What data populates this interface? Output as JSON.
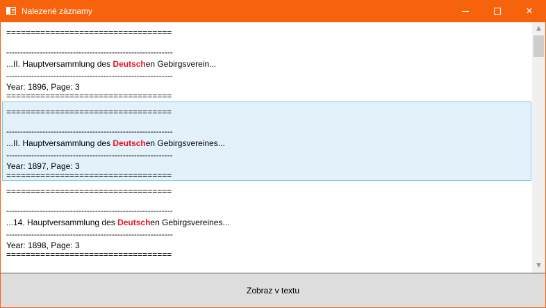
{
  "window": {
    "title": "Nalezené záznamy",
    "controls": {
      "minimize": "minimize",
      "maximize": "maximize",
      "close": "✕"
    }
  },
  "records": [
    {
      "sep_top": "==================================",
      "dash_a": "------------------------------------------------------------",
      "prefix": "...II. Hauptversammlung des ",
      "highlight": "Deutsch",
      "suffix": "en Gebirgsverein...",
      "dash_b": "------------------------------------------------------------",
      "meta": "Year: 1896, Page: 3",
      "sep_bottom": "==================================",
      "selected": false
    },
    {
      "sep_top": "==================================",
      "dash_a": "------------------------------------------------------------",
      "prefix": "...II. Hauptversammlung des ",
      "highlight": "Deutsch",
      "suffix": "en Gebirgsvereines...",
      "dash_b": "------------------------------------------------------------",
      "meta": "Year: 1897, Page: 3",
      "sep_bottom": "==================================",
      "selected": true
    },
    {
      "sep_top": "==================================",
      "dash_a": "------------------------------------------------------------",
      "prefix": "...14. Hauptversammlung des ",
      "highlight": "Deutsch",
      "suffix": "en Gebirgsvereines...",
      "dash_b": "------------------------------------------------------------",
      "meta": "Year: 1898, Page: 3",
      "sep_bottom": "==================================",
      "selected": false
    }
  ],
  "scrollbar": {
    "up": "▲",
    "down": "▼"
  },
  "action_button": {
    "label": "Zobraz v textu"
  },
  "colors": {
    "titlebar": "#f7630c",
    "highlight": "#e81123",
    "selection": "#e3f1fa"
  }
}
